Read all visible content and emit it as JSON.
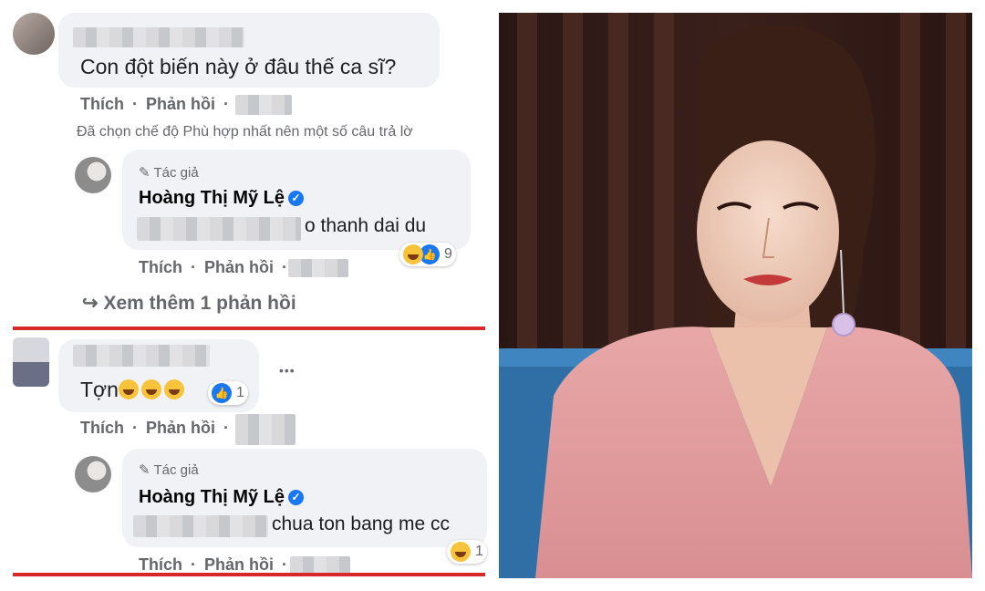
{
  "comment1": {
    "text": "Con đột biến này ở đâu thế ca sĩ?",
    "like": "Thích",
    "reply": "Phản hồi",
    "sep": "·"
  },
  "notice": "Đã chọn chế độ Phù hợp nhất nên một số câu trả lờ",
  "reply1": {
    "tag": "Tác giả",
    "author": "Hoàng Thị Mỹ Lệ",
    "text": "o thanh dai du",
    "reaction_count": "9",
    "like": "Thích",
    "reply": "Phản hồi",
    "sep": "·"
  },
  "more_replies": "Xem thêm 1 phản hồi",
  "comment2": {
    "text": "Tợn",
    "reaction_count": "1",
    "like": "Thích",
    "reply": "Phản hồi",
    "sep": "·",
    "more": "•••"
  },
  "reply2": {
    "tag": "Tác giả",
    "author": "Hoàng Thị Mỹ Lệ",
    "text": "chua ton bang me cc",
    "reaction_count": "1",
    "like": "Thích",
    "reply": "Phản hồi",
    "sep": "·"
  },
  "colors": {
    "separator": "#d62828",
    "bubble": "#f0f2f5",
    "verified": "#1877f2"
  },
  "photo": {
    "icon": "woman-portrait-photo"
  }
}
